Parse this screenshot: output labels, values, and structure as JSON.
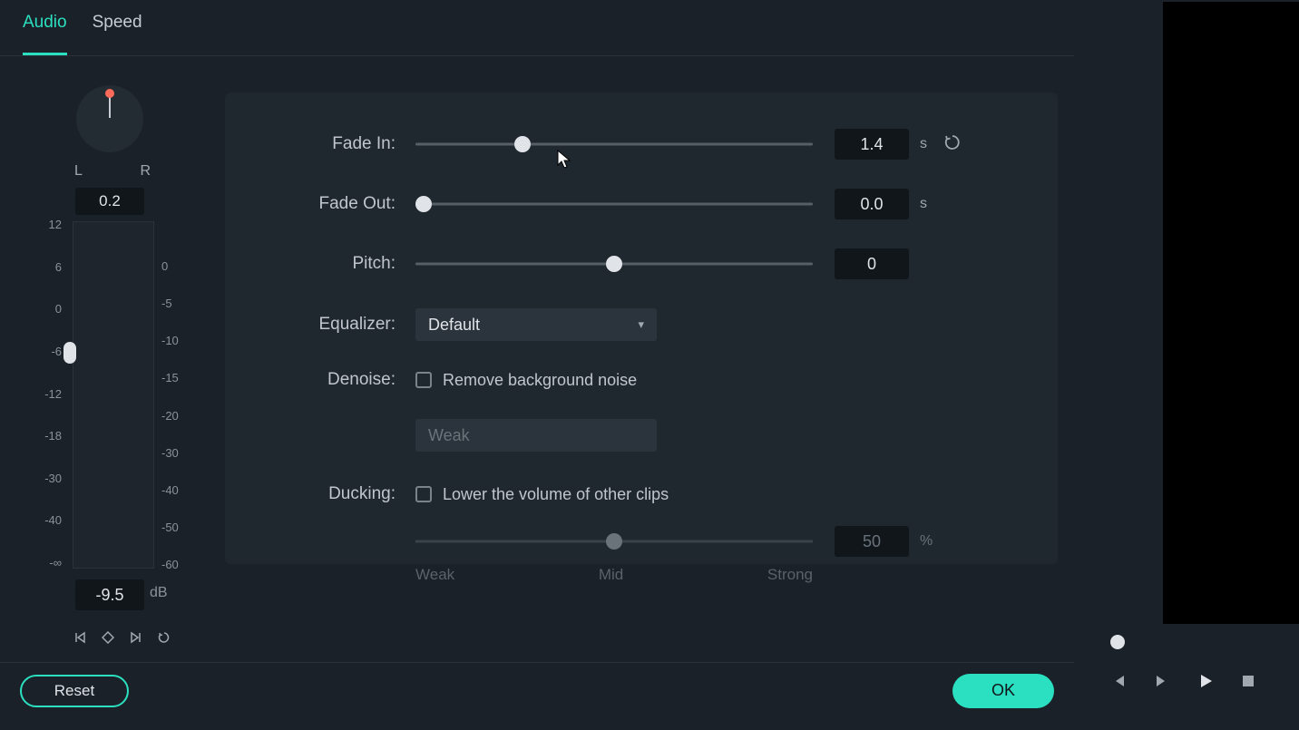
{
  "tabs": {
    "audio": "Audio",
    "speed": "Speed"
  },
  "pan": {
    "l": "L",
    "r": "R",
    "value": "0.2"
  },
  "meter": {
    "left_scale": [
      "12",
      "6",
      "0",
      "-6",
      "-12",
      "-18",
      "-30",
      "-40",
      "-∞"
    ],
    "right_scale": [
      "0",
      "-5",
      "-10",
      "-15",
      "-20",
      "-30",
      "-40",
      "-50",
      "-60"
    ],
    "db_value": "-9.5",
    "db_unit": "dB"
  },
  "sliders": {
    "fade_in": {
      "label": "Fade In:",
      "value": "1.4",
      "unit": "s",
      "pos": 27
    },
    "fade_out": {
      "label": "Fade Out:",
      "value": "0.0",
      "unit": "s",
      "pos": 2
    },
    "pitch": {
      "label": "Pitch:",
      "value": "0",
      "pos": 50
    }
  },
  "equalizer": {
    "label": "Equalizer:",
    "value": "Default"
  },
  "denoise": {
    "label": "Denoise:",
    "check_label": "Remove background noise",
    "strength": "Weak"
  },
  "ducking": {
    "label": "Ducking:",
    "check_label": "Lower the volume of other clips",
    "value": "50",
    "unit": "%",
    "weak": "Weak",
    "mid": "Mid",
    "strong": "Strong"
  },
  "buttons": {
    "reset": "Reset",
    "ok": "OK"
  }
}
